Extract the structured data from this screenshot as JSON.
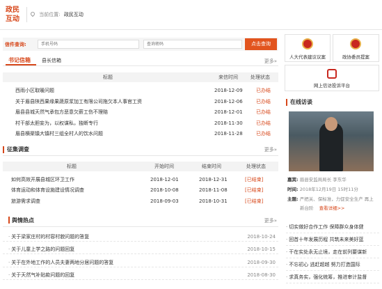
{
  "header": {
    "logo_line1": "政民",
    "logo_line2": "互动",
    "location_label": "当前位置:",
    "location_value": "政民互动"
  },
  "query": {
    "label": "信件查询:",
    "phone_placeholder": "手机号码",
    "code_placeholder": "查询密码",
    "button": "点击查询"
  },
  "mail": {
    "tabs": [
      "书记信箱",
      "县长信箱"
    ],
    "more": "更多»",
    "columns": [
      "标题",
      "来信时间",
      "处理状态"
    ],
    "rows": [
      {
        "title": "西雨小区取暖问题",
        "date": "2018-12-09",
        "status": "已办结"
      },
      {
        "title": "关于眉县陕西果缘果蔬原浆加工有限公司拖欠本人事官工资",
        "date": "2018-12-06",
        "status": "已办结"
      },
      {
        "title": "眉县县城天然气承包方恶意欠薪工伤不理赔",
        "date": "2018-12-01",
        "status": "已办结"
      },
      {
        "title": "村干部太胆妄为，以权谋私，独断专行",
        "date": "2018-11-30",
        "status": "已办结"
      },
      {
        "title": "眉县横渠镇大镇村三组全村人的饮水问题",
        "date": "2018-11-28",
        "status": "已办结"
      }
    ]
  },
  "survey": {
    "title": "征集调查",
    "more": "更多»",
    "columns": [
      "标题",
      "开始时间",
      "结束时间",
      "处理状态"
    ],
    "rows": [
      {
        "title": "如何高效开展县城区环卫工作",
        "start": "2018-12-01",
        "end": "2018-12-31",
        "status": "[已结束]"
      },
      {
        "title": "体育运动和体育设施建设情况调查",
        "start": "2018-10-08",
        "end": "2018-11-08",
        "status": "[已结束]"
      },
      {
        "title": "旅游需求调查",
        "start": "2018-09-03",
        "end": "2018-10-31",
        "status": "[已结束]"
      }
    ]
  },
  "hot": {
    "title": "舆情热点",
    "more": "更多»",
    "rows": [
      {
        "title": "关于梁家庄村的村容村貌问题的答复",
        "date": "2018-10-24"
      },
      {
        "title": "关于儿童上学之路的问题回复",
        "date": "2018-10-15"
      },
      {
        "title": "关于在外地工作的人员夫妻两地分居问题的答复",
        "date": "2018-09-30"
      },
      {
        "title": "关于天然气补贴款问题的回复",
        "date": "2018-08-30"
      }
    ]
  },
  "sidebar": {
    "btn1": "人大代表建议议案",
    "btn2": "政协委员提案",
    "btn3": "网上信访投诉平台",
    "interview_title": "在线访谈",
    "guest_label": "嘉宾:",
    "guest_value": "眉县安监局局长 李东华",
    "time_label": "时间:",
    "time_value": "2018年12月19日 15时11分",
    "topic_label": "主题:",
    "topic_value": "严把关、保标准，力促安全生产 再上",
    "topic_value2": "新台阶",
    "review_link": "查看详细>>",
    "links": [
      "切实做好合作工作 保障群众身体健",
      "回首十年发展历程 共筑未来美好蓝",
      "干在实处永无止境，走在前列要谋新",
      "不忘初心 逃赶超越 努力打造国际",
      "求真务实，强化统筹，推进审计监督"
    ]
  }
}
